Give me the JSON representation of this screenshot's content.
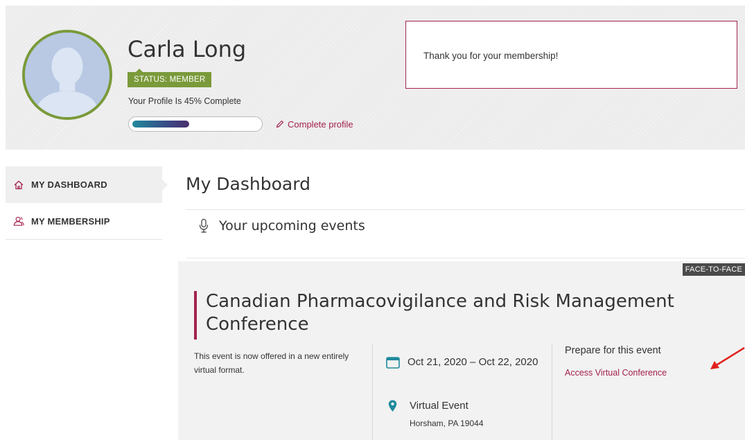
{
  "profile": {
    "name": "Carla Long",
    "status_badge": "STATUS: MEMBER",
    "completion_text": "Your Profile Is 45% Complete",
    "completion_fraction": 0.45,
    "complete_profile_link": "Complete profile",
    "avatar_icon": "default-user-avatar",
    "edit_icon": "pencil-icon"
  },
  "notice": {
    "message": "Thank you for your membership!"
  },
  "sidebar": {
    "items": [
      {
        "label": "MY DASHBOARD",
        "icon": "home-icon",
        "active": true
      },
      {
        "label": "MY MEMBERSHIP",
        "icon": "members-icon",
        "active": false
      }
    ]
  },
  "main": {
    "title": "My Dashboard",
    "section_heading": "Your upcoming events",
    "section_icon": "microphone-icon"
  },
  "event": {
    "tag": "FACE-TO-FACE",
    "title": "Canadian Pharmacovigilance and Risk Management Conference",
    "description": "This event is now offered in a new entirely virtual format.",
    "dates": "Oct 21, 2020 – Oct 22, 2020",
    "venue_name": "Virtual Event",
    "venue_address": "Horsham, PA 19044",
    "prepare_heading": "Prepare for this event",
    "access_link": "Access Virtual Conference"
  },
  "colors": {
    "accent": "#a3214f",
    "status_green": "#7a9a3a",
    "teal_icon": "#1f8a9c",
    "annotation_red": "#e0201b"
  }
}
